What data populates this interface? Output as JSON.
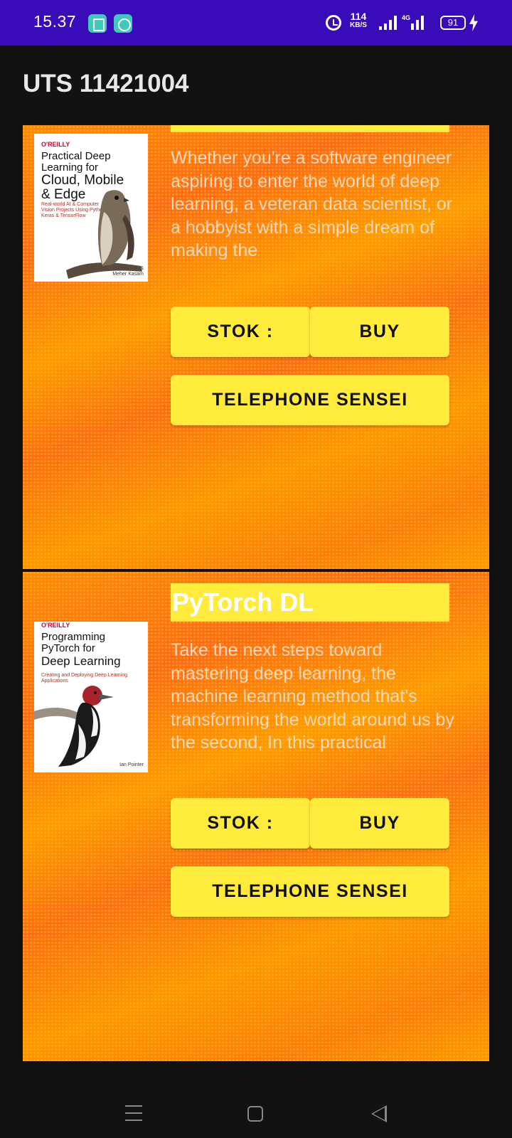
{
  "status_bar": {
    "time": "15.37",
    "net_speed": "114",
    "net_speed_unit": "KB/S",
    "network": "4G",
    "battery": "91"
  },
  "app_bar": {
    "title": "UTS 11421004"
  },
  "books": [
    {
      "title": "",
      "cover": {
        "publisher": "O'REILLY",
        "title_lines": [
          "Practical Deep",
          "Learning for",
          "Cloud, Mobile",
          "& Edge"
        ],
        "subtitle": "Real-world AI & Computer Vision Projects Using Python, Keras & TensorFlow",
        "authors": "Anirudh Koul, Siddha Ganju & Meher Kasam"
      },
      "description": "Whether you're a software engineer aspiring to enter the world of deep learning, a veteran data scientist, or a hobbyist with a simple dream of making the",
      "stok_label": "STOK :",
      "buy_label": "BUY",
      "telephone_label": "TELEPHONE SENSEI"
    },
    {
      "title": "PyTorch DL",
      "cover": {
        "publisher": "O'REILLY",
        "title_lines": [
          "Programming",
          "PyTorch for",
          "Deep Learning"
        ],
        "subtitle": "Creating and Deploying Deep Learning Applications",
        "authors": "Ian Pointer"
      },
      "description": "Take the next steps toward mastering deep learning, the machine learning method that's transforming the world around us by the second, In this practical",
      "stok_label": "STOK :",
      "buy_label": "BUY",
      "telephone_label": "TELEPHONE SENSEI"
    }
  ],
  "colors": {
    "status_bar": "#3a0bb8",
    "button": "#ffeb3b",
    "card_orange": "#ff8a08"
  }
}
